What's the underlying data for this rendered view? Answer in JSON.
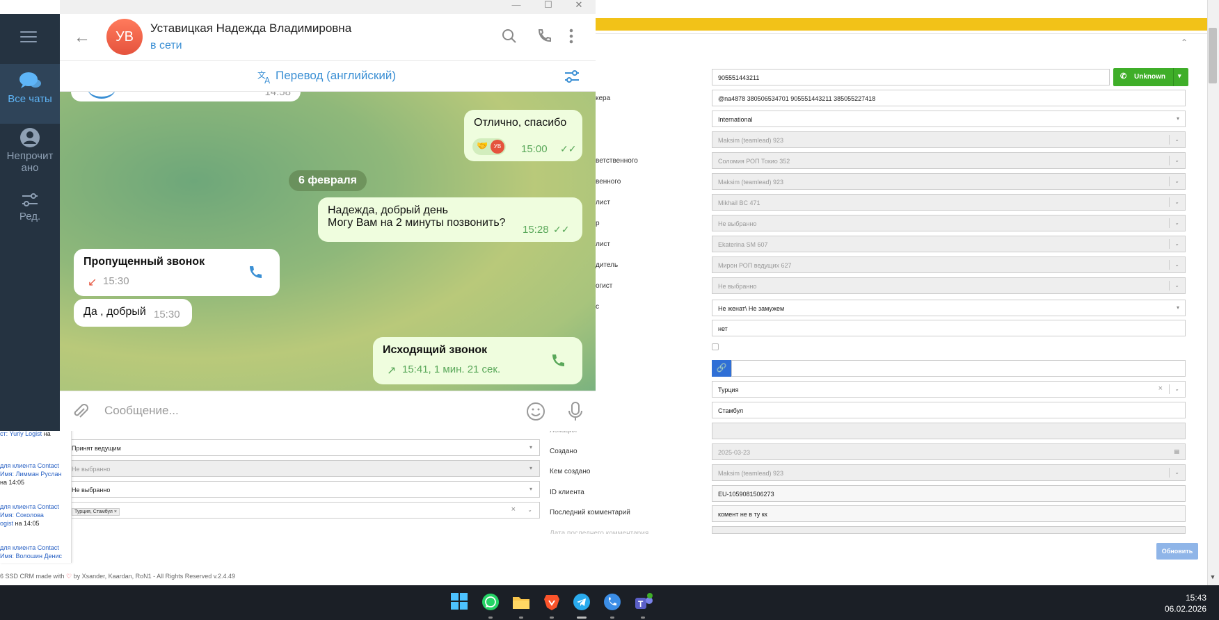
{
  "telegram": {
    "sidebar": {
      "all_chats": "Все чаты",
      "unread_line1": "Непрочит",
      "unread_line2": "ано",
      "edit": "Ред."
    },
    "header": {
      "avatar_initials": "УВ",
      "name": "Уставицкая Надежда Владимировна",
      "status": "в сети"
    },
    "translate_bar": "Перевод (английский)",
    "partial_time": "14:58",
    "messages": {
      "m1_text": "Отлично, спасибо",
      "m1_reaction_initials": "УВ",
      "m1_time": "15:00",
      "date_separator": "6 февраля",
      "m2_line1": "Надежда, добрый день",
      "m2_line2": "Могу Вам на 2 минуты позвонить?",
      "m2_time": "15:28",
      "m3_title": "Пропущенный звонок",
      "m3_time": "15:30",
      "m4_text": "Да , добрый",
      "m4_time": "15:30",
      "m5_title": "Исходящий звонок",
      "m5_details": "15:41, 1 мин. 21 сек."
    },
    "input_placeholder": "Сообщение..."
  },
  "crm": {
    "labels": {
      "l1": "кера",
      "l2": "ветственного",
      "l3": "венного",
      "l4": "лист",
      "l5": "р",
      "l6": "лист",
      "l7": "дитель",
      "l8": "огист",
      "l9": "с",
      "location": "Локация",
      "created": "Создано",
      "created_by": "Кем создано",
      "client_id": "ID клиента",
      "last_comment": "Последний комментарий",
      "last_comment_date": "Дата последнего комментария"
    },
    "fields": {
      "phone": "905551443211",
      "contacts": "@na4878 380506534701 905551443211   385055227418",
      "market": "International",
      "teamlead": "Maksim (teamlead) 923",
      "rop": "Соломия РОП Токио 352",
      "responsible": "Maksim (teamlead) 923",
      "specialist": "Mikhail BC 471",
      "manager": "Не выбранно",
      "specialist2": "Ekaterina SM 607",
      "leader": "Мирон РОП ведущих 627",
      "logist": "Не выбранно",
      "marital": "Не женат\\ Не замужем",
      "answer": "нет",
      "country": "Турция",
      "city": "Стамбул",
      "created": "2025-03-23",
      "created_by": "Maksim (teamlead) 923",
      "client_id": "EU-1059081506273",
      "last_comment": "комент не в ту кк"
    },
    "call_button": "Unknown",
    "left_fields": {
      "status": "Принят ведущим",
      "f2": "Не выбранно",
      "f3": "Не выбранно",
      "tag": "Турция, Стамбул"
    },
    "notifications": {
      "n1_link": "ст: Yuriy Logist",
      "n1_plain": " на",
      "n2_link1": "для клиента Contact",
      "n2_link2": "Имя: Лимман Руслан",
      "n2_plain": "на 14:05",
      "n3_link1": "для клиента Contact",
      "n3_link2": "Имя: Соколова",
      "n3_link3": "ogist",
      "n3_plain": " на 14:05",
      "n4_link1": "для клиента Contact",
      "n4_link2": "Имя: Волошин Денис"
    },
    "update_button": "Обновить",
    "footer_pre": "6 SSD CRM made with ",
    "footer_post": " by Xsander, Kaardan, RoN1 - All Rights Reserved v.2.4.49"
  },
  "taskbar": {
    "time": "15:43",
    "date": "06.02.2026",
    "apps": [
      "windows-start",
      "whatsapp",
      "file-explorer",
      "brave",
      "telegram",
      "phone",
      "teams"
    ]
  },
  "colors": {
    "telegram_sidebar": "#253341",
    "telegram_accent": "#3a8fd4",
    "outgoing_bubble": "#effdde",
    "crm_yellow": "#f2c218",
    "call_green": "#3fae29"
  }
}
